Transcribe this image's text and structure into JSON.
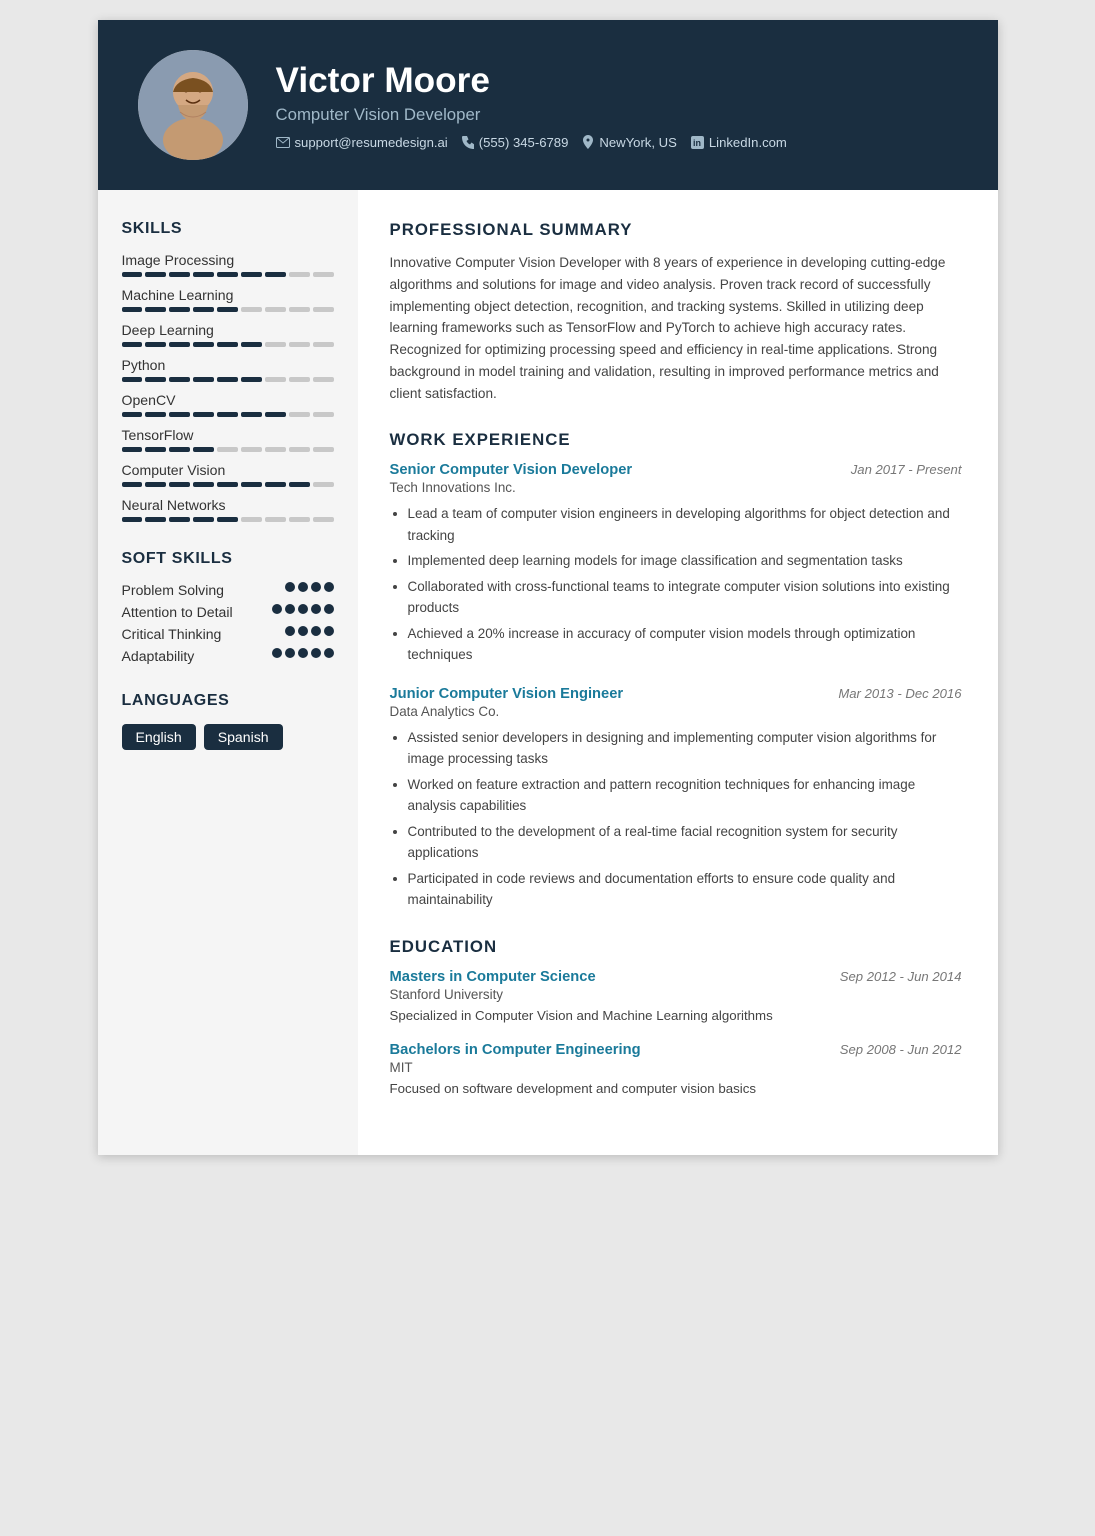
{
  "header": {
    "name": "Victor Moore",
    "job_title": "Computer Vision Developer",
    "contact": {
      "email": "support@resumedesign.ai",
      "phone": "(555) 345-6789",
      "location": "NewYork, US",
      "linkedin": "LinkedIn.com"
    }
  },
  "skills_title": "SKILLS",
  "skills": [
    {
      "name": "Image Processing",
      "filled": 7,
      "total": 9
    },
    {
      "name": "Machine Learning",
      "filled": 5,
      "total": 9
    },
    {
      "name": "Deep Learning",
      "filled": 6,
      "total": 9
    },
    {
      "name": "Python",
      "filled": 6,
      "total": 9
    },
    {
      "name": "OpenCV",
      "filled": 7,
      "total": 9
    },
    {
      "name": "TensorFlow",
      "filled": 4,
      "total": 9
    },
    {
      "name": "Computer Vision",
      "filled": 8,
      "total": 9
    },
    {
      "name": "Neural Networks",
      "filled": 5,
      "total": 9
    }
  ],
  "soft_skills_title": "SOFT SKILLS",
  "soft_skills": [
    {
      "name": "Problem Solving",
      "dots": 4
    },
    {
      "name": "Attention to Detail",
      "dots": 5
    },
    {
      "name": "Critical Thinking",
      "dots": 4
    },
    {
      "name": "Adaptability",
      "dots": 5
    }
  ],
  "languages_title": "LANGUAGES",
  "languages": [
    "English",
    "Spanish"
  ],
  "summary_title": "PROFESSIONAL SUMMARY",
  "summary": "Innovative Computer Vision Developer with 8 years of experience in developing cutting-edge algorithms and solutions for image and video analysis. Proven track record of successfully implementing object detection, recognition, and tracking systems. Skilled in utilizing deep learning frameworks such as TensorFlow and PyTorch to achieve high accuracy rates. Recognized for optimizing processing speed and efficiency in real-time applications. Strong background in model training and validation, resulting in improved performance metrics and client satisfaction.",
  "work_title": "WORK EXPERIENCE",
  "jobs": [
    {
      "title": "Senior Computer Vision Developer",
      "date": "Jan 2017 - Present",
      "company": "Tech Innovations Inc.",
      "bullets": [
        "Lead a team of computer vision engineers in developing algorithms for object detection and tracking",
        "Implemented deep learning models for image classification and segmentation tasks",
        "Collaborated with cross-functional teams to integrate computer vision solutions into existing products",
        "Achieved a 20% increase in accuracy of computer vision models through optimization techniques"
      ]
    },
    {
      "title": "Junior Computer Vision Engineer",
      "date": "Mar 2013 - Dec 2016",
      "company": "Data Analytics Co.",
      "bullets": [
        "Assisted senior developers in designing and implementing computer vision algorithms for image processing tasks",
        "Worked on feature extraction and pattern recognition techniques for enhancing image analysis capabilities",
        "Contributed to the development of a real-time facial recognition system for security applications",
        "Participated in code reviews and documentation efforts to ensure code quality and maintainability"
      ]
    }
  ],
  "education_title": "EDUCATION",
  "education": [
    {
      "degree": "Masters in Computer Science",
      "date": "Sep 2012 - Jun 2014",
      "school": "Stanford University",
      "desc": "Specialized in Computer Vision and Machine Learning algorithms"
    },
    {
      "degree": "Bachelors in Computer Engineering",
      "date": "Sep 2008 - Jun 2012",
      "school": "MIT",
      "desc": "Focused on software development and computer vision basics"
    }
  ]
}
